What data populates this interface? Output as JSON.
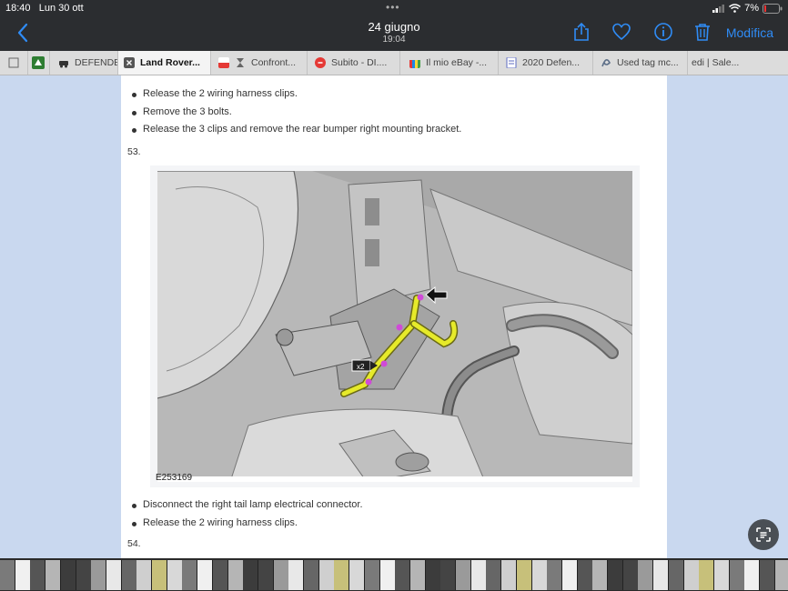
{
  "status": {
    "time": "18:40",
    "date": "Lun 30 ott",
    "battery": "7%"
  },
  "header": {
    "title": "24 giugno",
    "subtitle": "19:04",
    "edit_label": "Modifica"
  },
  "tabs": [
    {
      "label": "DEFENDE",
      "active": false
    },
    {
      "label": "Land Rover...",
      "active": true
    },
    {
      "label": "Confront...",
      "active": false
    },
    {
      "label": "Subito - DI....",
      "active": false
    },
    {
      "label": "Il mio eBay -...",
      "active": false
    },
    {
      "label": "2020 Defen...",
      "active": false
    },
    {
      "label": "Used tag mc...",
      "active": false
    },
    {
      "label": "edi | Sale...",
      "active": false
    }
  ],
  "document": {
    "bullets_top": [
      "Release the 2 wiring harness clips.",
      "Remove the 3 bolts.",
      "Release the 3 clips and remove the rear bumper right mounting bracket."
    ],
    "step_53": "53.",
    "figure_id": "E253169",
    "callout_label": "x2",
    "bullets_bottom": [
      "Disconnect the right tail lamp electrical connector.",
      "Release the 2 wiring harness clips."
    ],
    "step_54": "54."
  },
  "colors": {
    "accent": "#2f8cf6",
    "harness": "#e6ea2a",
    "page_bg": "#c9d8ef"
  }
}
